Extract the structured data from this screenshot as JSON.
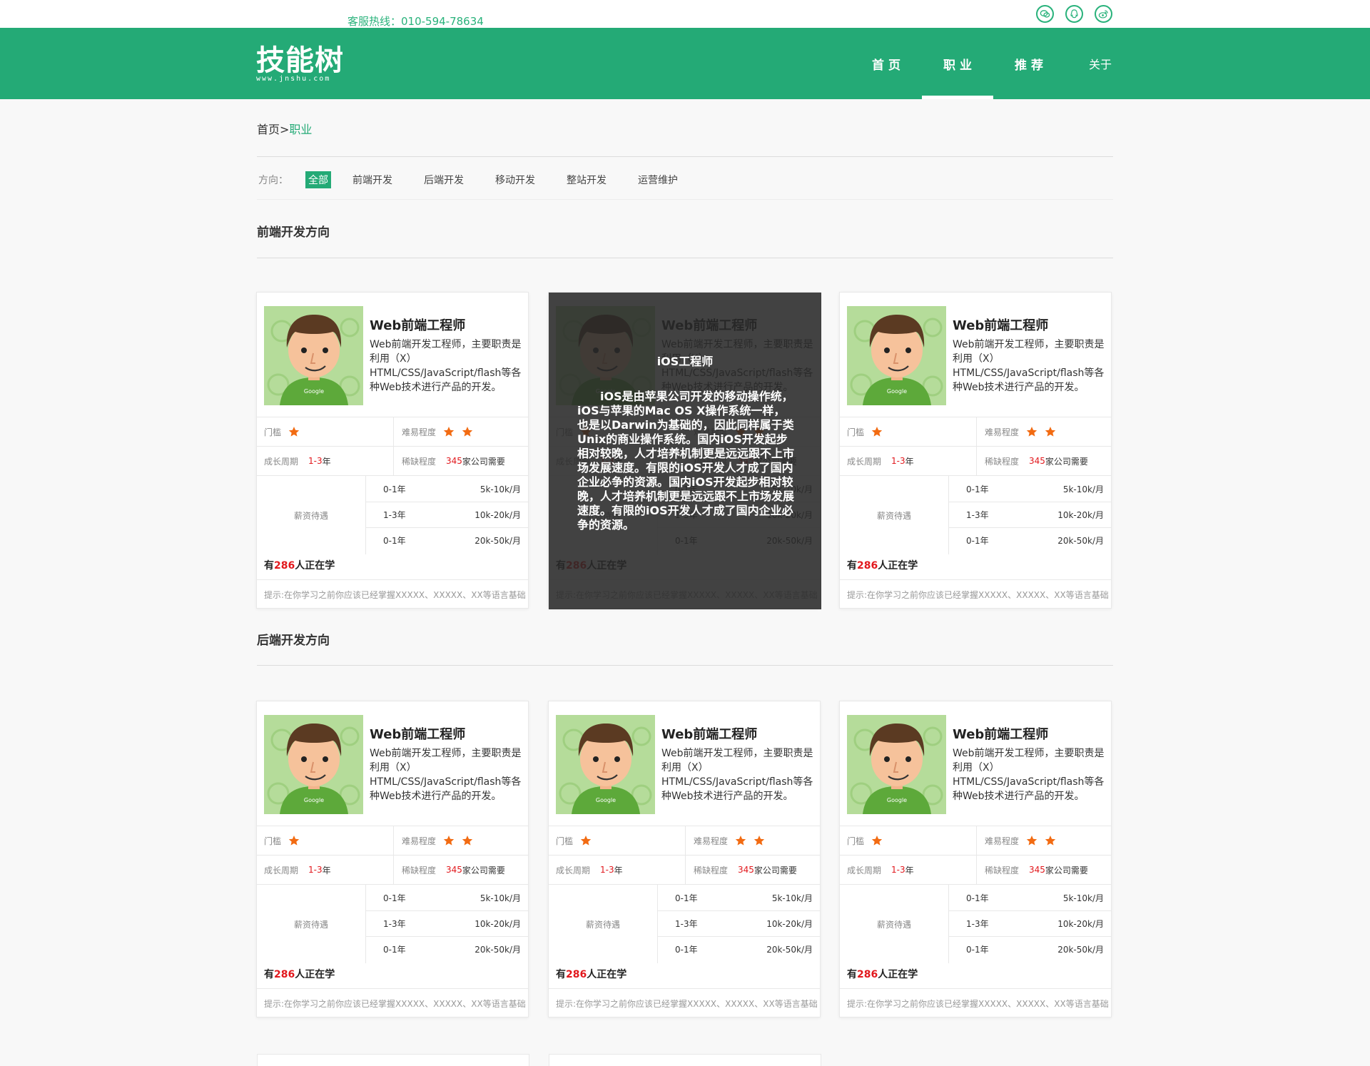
{
  "topbar": {
    "hotline": "客服热线：010-594-78634",
    "social_icons": [
      "wechat-icon",
      "qq-icon",
      "weibo-icon"
    ]
  },
  "header": {
    "logo_text": "技能树",
    "logo_sub": "www.jnshu.com",
    "nav": [
      "首 页",
      "职 业",
      "推 荐",
      "关于"
    ],
    "active_nav": "职 业"
  },
  "breadcrumb": {
    "home": "首页",
    "separator": ">",
    "current": "职业"
  },
  "filter": {
    "label": "方向：",
    "options": [
      "全部",
      "前端开发",
      "后端开发",
      "移动开发",
      "整站开发",
      "运营维护"
    ],
    "active": "全部"
  },
  "sections": [
    {
      "title": "前端开发方向"
    },
    {
      "title": "后端开发方向"
    }
  ],
  "card": {
    "title": "Web前端工程师",
    "desc": "Web前端开发工程师，主要职责是利用（X）HTML/CSS/JavaScript/flash等各种Web技术进行产品的开发。",
    "threshold_label": "门槛",
    "threshold_stars": 1,
    "difficulty_label": "难易程度",
    "difficulty_stars": 2,
    "growth_label": "成长周期",
    "growth_value": "1-3",
    "growth_unit": "年",
    "scarcity_label": "稀缺程度",
    "scarcity_value": "345",
    "scarcity_unit": "家公司需要",
    "salary_label": "薪资待遇",
    "salary": [
      {
        "years": "0-1年",
        "range": "5k-10k/月"
      },
      {
        "years": "1-3年",
        "range": "10k-20k/月"
      },
      {
        "years": "0-1年",
        "range": "20k-50k/月"
      }
    ],
    "learn_prefix": "有",
    "learn_count": "286",
    "learn_suffix": "人正在学",
    "tip": "提示:在你学习之前你应该已经掌握XXXXX、XXXXX、XX等语言基础"
  },
  "hover_overlay": {
    "title": "iOS工程师",
    "text": "iOS是由苹果公司开发的移动操作统，iOS与苹果的Mac OS X操作系统一样，也是以Darwin为基础的，因此同样属于类Unix的商业操作系统。国内iOS开发起步相对较晚，人才培养机制更是远远跟不上市场发展速度。有限的iOS开发人才成了国内企业必争的资源。国内iOS开发起步相对较晚，人才培养机制更是远远跟不上市场发展速度。有限的iOS开发人才成了国内企业必争的资源。"
  },
  "colors": {
    "brand": "#24aa76",
    "highlight": "#e2181d",
    "star": "#f26b12",
    "overlay": "#282828"
  }
}
